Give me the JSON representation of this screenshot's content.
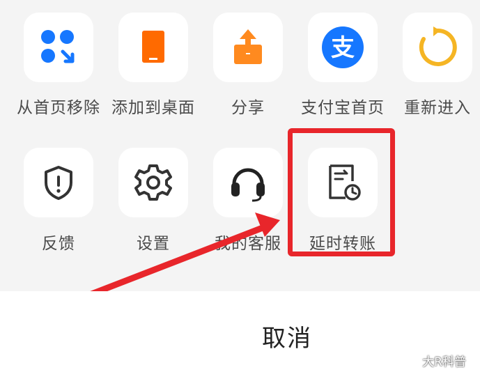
{
  "row1": [
    {
      "label": "从首页移除",
      "icon": "remove-from-home-icon"
    },
    {
      "label": "添加到桌面",
      "icon": "tablet-icon"
    },
    {
      "label": "分享",
      "icon": "share-icon"
    },
    {
      "label": "支付宝首页",
      "icon": "alipay-icon"
    },
    {
      "label": "重新进入",
      "icon": "reload-icon"
    }
  ],
  "row2": [
    {
      "label": "反馈",
      "icon": "shield-alert-icon"
    },
    {
      "label": "设置",
      "icon": "gear-icon"
    },
    {
      "label": "我的客服",
      "icon": "headset-icon"
    },
    {
      "label": "延时转账",
      "icon": "delayed-transfer-icon"
    }
  ],
  "cancel_label": "取消",
  "watermark": "大R科普",
  "colors": {
    "blue": "#1677ff",
    "orange": "#ff6a00",
    "alipay": "#1677ff",
    "reload": "#f5b524",
    "red": "#e8262b"
  }
}
